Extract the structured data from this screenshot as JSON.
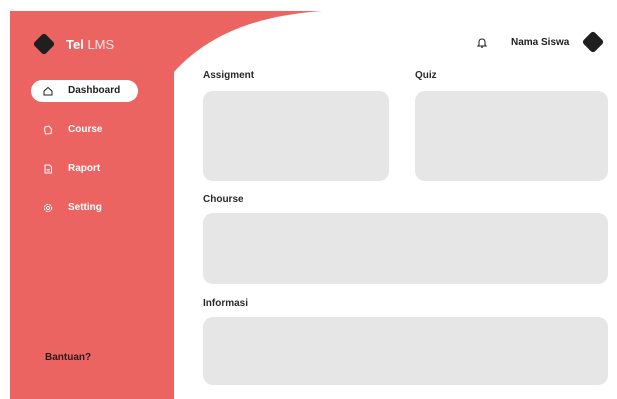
{
  "brand": {
    "name_bold": "Tel",
    "name_light": "LMS",
    "icon": "diamond-logo-icon"
  },
  "sidebar": {
    "items": [
      {
        "label": "Dashboard",
        "icon": "home-icon",
        "active": true
      },
      {
        "label": "Course",
        "icon": "book-icon",
        "active": false
      },
      {
        "label": "Raport",
        "icon": "document-icon",
        "active": false
      },
      {
        "label": "Setting",
        "icon": "gear-icon",
        "active": false
      }
    ],
    "help_label": "Bantuan?"
  },
  "header": {
    "notification_icon": "bell-icon",
    "username": "Nama Siswa",
    "avatar_icon": "diamond-avatar-icon"
  },
  "main": {
    "assignment_title": "Assigment",
    "quiz_title": "Quiz",
    "course_title": "Chourse",
    "info_title": "Informasi"
  },
  "colors": {
    "sidebar": "#ec6461",
    "card": "#e6e6e6",
    "dark": "#1f1f1f",
    "background": "#ffffff"
  }
}
